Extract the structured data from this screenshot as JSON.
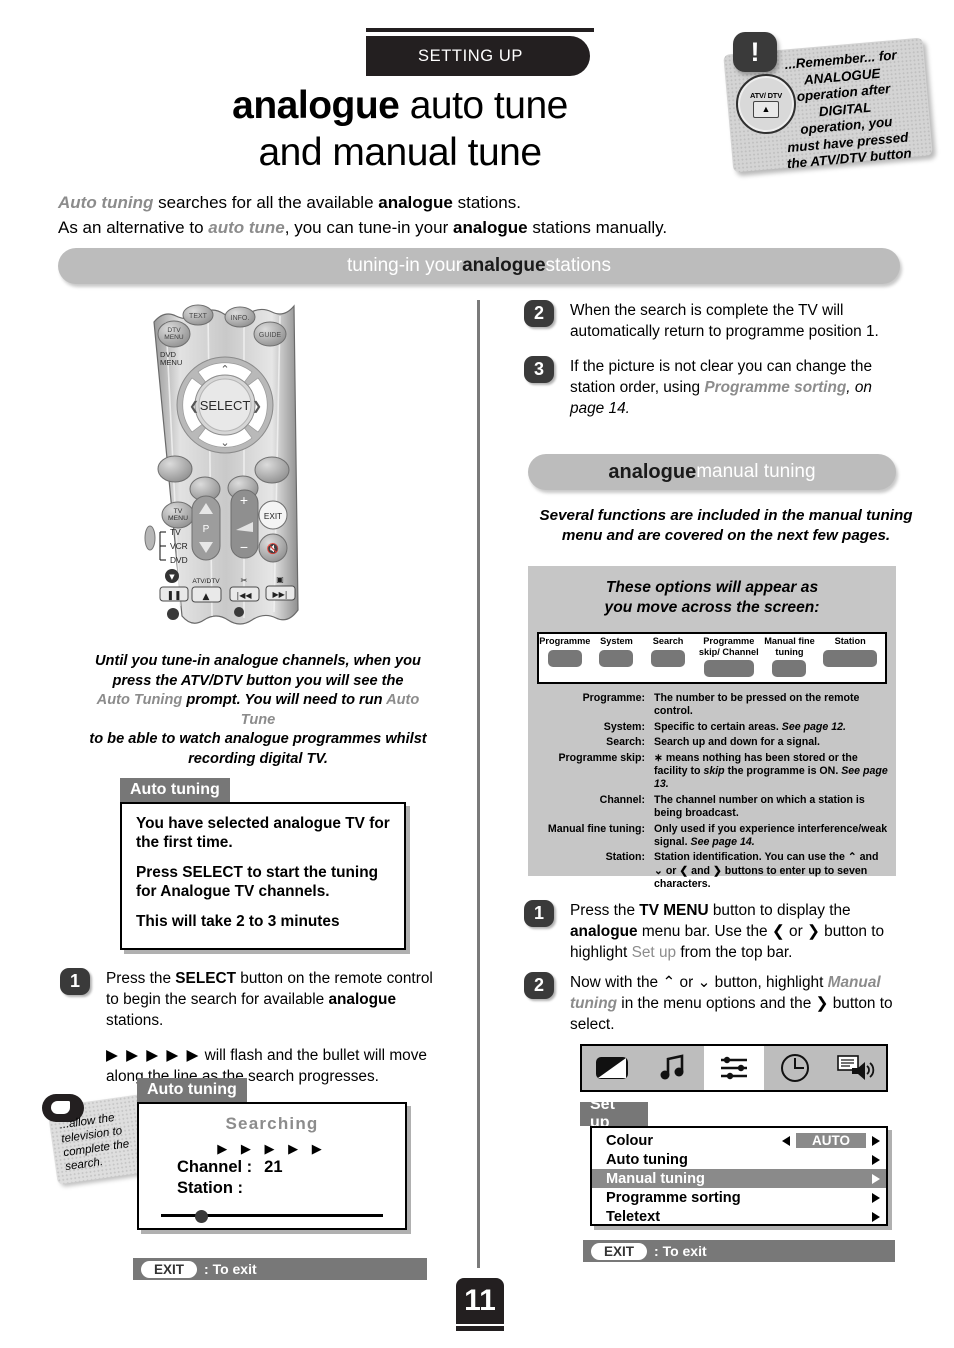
{
  "header": {
    "section_tab": "SETTING UP",
    "title_line1_bold": "analogue",
    "title_line1_light": " auto tune",
    "title_line2": "and manual tune"
  },
  "remember_note": {
    "bang": "!",
    "button_label": "ATV/ DTV",
    "eject_glyph": "▲",
    "lines": [
      "...Remember... for",
      "ANALOGUE",
      "operation after",
      "DIGITAL",
      "operation, you",
      "must have pressed",
      "the ATV/DTV button"
    ]
  },
  "intro": {
    "line1_a": "Auto tuning",
    "line1_b": " searches for all the available ",
    "line1_c": "analogue",
    "line1_d": " stations.",
    "line2_a": "As an alternative to ",
    "line2_b": "auto tune",
    "line2_c": ", you can tune-in your ",
    "line2_d": "analogue",
    "line2_e": " stations manually."
  },
  "bars": {
    "tuning_pre": "tuning-in your ",
    "tuning_bold": "analogue",
    "tuning_post": " stations",
    "manual_bold": "analogue",
    "manual_post": " manual tuning"
  },
  "remote": {
    "labels": [
      "TEXT",
      "INFO.",
      "DTV MENU",
      "GUIDE",
      "DVD MENU",
      "SELECT",
      "TV MENU",
      "EXIT",
      "P",
      "TV",
      "VCR",
      "DVD",
      "ATV/DTV"
    ]
  },
  "remote_note": {
    "l1": "Until you tune-in analogue channels, when you",
    "l2": "press the ATV/DTV button you will see the",
    "l3_a": "Auto Tuning",
    "l3_b": " prompt. You will need to run ",
    "l3_c": "Auto Tune",
    "l4": "to be able to watch analogue programmes whilst",
    "l5": "recording digital TV."
  },
  "osd_auto_tuning_1": {
    "tab": "Auto tuning",
    "p1": "You have selected analogue TV for the first time.",
    "p2": "Press SELECT to start the tuning for Analogue TV channels.",
    "p3": "This will take 2 to 3 minutes"
  },
  "osd_auto_tuning_2": {
    "tab": "Auto tuning",
    "searching": "Searching",
    "arrows": "▶ ▶ ▶ ▶ ▶",
    "channel_label": "Channel :",
    "channel_value": "21",
    "station_label": "Station  :",
    "station_value": ""
  },
  "allow_note": {
    "l1": "...allow the",
    "l2": "television to",
    "l3": "complete the",
    "l4": "search."
  },
  "exit_bars": {
    "pill": "EXIT",
    "text": ": To exit"
  },
  "steps_left": [
    {
      "num": "1",
      "p1_a": "Press the ",
      "p1_b": "SELECT",
      "p1_c": " button on the remote control to begin the search for available ",
      "p1_d": "analogue",
      "p1_e": " stations.",
      "p2_arrows": "▶ ▶ ▶ ▶ ▶",
      "p2_text": " will flash and the bullet will move along the line as the search progresses."
    }
  ],
  "steps_right_top": [
    {
      "num": "2",
      "text": "When the search is complete the TV will automatically return to programme position 1."
    },
    {
      "num": "3",
      "a": "If the picture is not clear you can change the station order, using ",
      "b": "Programme sorting",
      "c": ", on ",
      "d": "page 14",
      "e": "."
    }
  ],
  "manual_intro": {
    "l1": "Several functions are included in the manual tuning",
    "l2": "menu and are covered on the next few pages."
  },
  "options_panel": {
    "title_l1": "These options will appear as",
    "title_l2": "you move across the screen:",
    "columns": [
      {
        "label": "Programme"
      },
      {
        "label": "System"
      },
      {
        "label": "Search"
      },
      {
        "label": "Programme skip/ Channel"
      },
      {
        "label": "Manual fine tuning"
      },
      {
        "label": "Station"
      }
    ],
    "definitions": [
      {
        "key": "Programme:",
        "value": "The number to be pressed on the remote control."
      },
      {
        "key": "System:",
        "value": "Specific to certain areas. ",
        "italic": "See page 12."
      },
      {
        "key": "Search:",
        "value": "Search up and down for a signal."
      },
      {
        "key": "Programme skip:",
        "value": "∗ means nothing has been stored or the facility to ",
        "italic_mid": "skip",
        "value2": " the programme is ON. ",
        "italic": "See page 13."
      },
      {
        "key": "Channel:",
        "value": "The channel number on which a station is being broadcast."
      },
      {
        "key": "Manual fine tuning:",
        "value": "Only used if you experience interference/weak signal. ",
        "italic": "See page 14."
      },
      {
        "key": "Station:",
        "value": "Station identification. You can use the ⌃ and ⌄ or ❮ and ❯ buttons to enter up to seven characters."
      }
    ]
  },
  "steps_right_bottom": [
    {
      "num": "1",
      "a": "Press the ",
      "b": "TV MENU",
      "c": " button to display the ",
      "d": "analogue",
      "e": " menu bar. Use the ❮ or ❯ button to highlight ",
      "f": "Set up",
      "g": " from the top bar."
    },
    {
      "num": "2",
      "a": "Now with the ⌃ or ⌄ button, highlight ",
      "b": "Manual tuning",
      "c": " in the menu options and the ❯ button to select."
    }
  ],
  "icon_bar": {
    "icons": [
      "picture-icon",
      "sound-icon",
      "setup-sliders-icon",
      "clock-icon",
      "teletext-speaker-icon"
    ],
    "active_index": 2
  },
  "setup_menu": {
    "tab": "Set up",
    "rows": [
      {
        "label": "Colour",
        "value": "AUTO",
        "type": "value",
        "selected": false
      },
      {
        "label": "Auto tuning",
        "value": "",
        "type": "arrow",
        "selected": false
      },
      {
        "label": "Manual tuning",
        "value": "",
        "type": "arrow",
        "selected": true
      },
      {
        "label": "Programme sorting",
        "value": "",
        "type": "arrow",
        "selected": false
      },
      {
        "label": "Teletext",
        "value": "",
        "type": "arrow",
        "selected": false
      }
    ]
  },
  "page_number": "11",
  "colors": {
    "dark": "#231f20",
    "bar_grey": "#bcbcbc",
    "panel_grey": "#c6c6c6",
    "osd_tab_grey": "#777777",
    "accent_grey": "#8c8c8c"
  }
}
